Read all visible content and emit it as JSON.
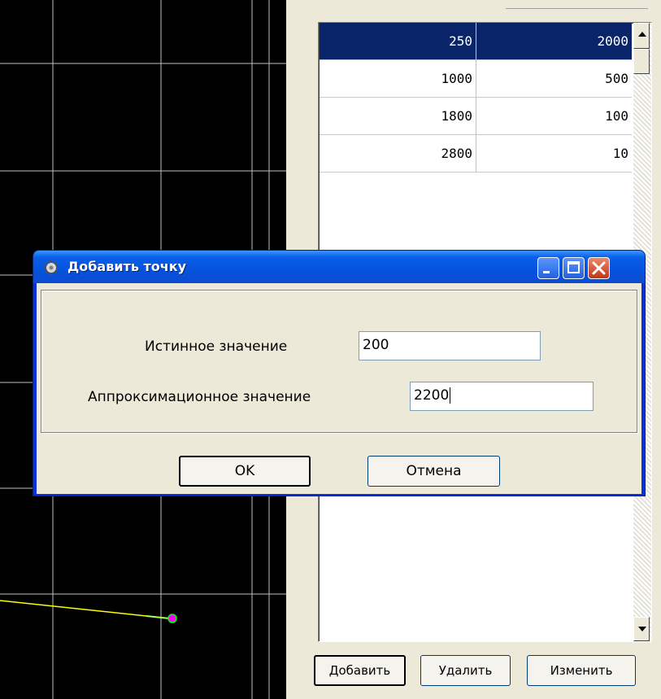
{
  "plot": {
    "background": "#000000",
    "grid_color": "#c0c0c0",
    "line_color": "#ffff00",
    "marker_color": "#ff00ff",
    "marker_outline": "#00ff00"
  },
  "table": {
    "rows": [
      {
        "col1": "250",
        "col2": "2000",
        "selected": true
      },
      {
        "col1": "1000",
        "col2": "500",
        "selected": false
      },
      {
        "col1": "1800",
        "col2": "100",
        "selected": false
      },
      {
        "col1": "2800",
        "col2": "10",
        "selected": false
      }
    ]
  },
  "buttons": {
    "add": "Добавить",
    "delete": "Удалить",
    "edit": "Изменить"
  },
  "dialog": {
    "title": "Добавить точку",
    "true_value_label": "Истинное значение",
    "true_value": "200",
    "approx_value_label": "Аппроксимационное значение",
    "approx_value": "2200",
    "ok": "OK",
    "cancel": "Отмена",
    "title_bar_color": "#0a5fe8",
    "close_button_color": "#c2351a"
  }
}
